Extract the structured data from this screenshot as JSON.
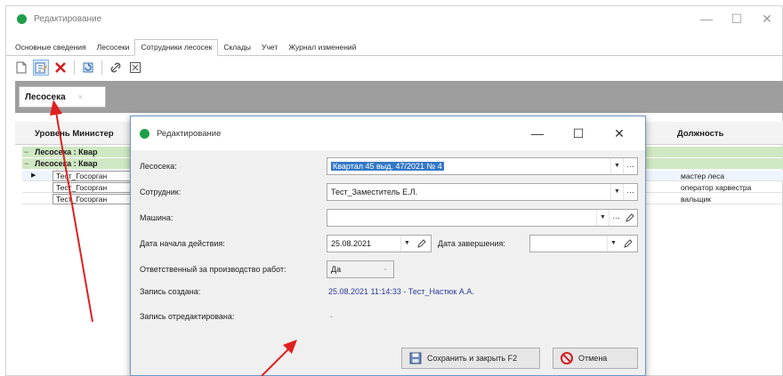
{
  "outer_window": {
    "title": "Редактирование",
    "controls": [
      "—",
      "☐",
      "✕"
    ]
  },
  "tabs": [
    {
      "label": "Основные сведения",
      "active": false
    },
    {
      "label": "Лесосеки",
      "active": false
    },
    {
      "label": "Сотрудники лесосек",
      "active": true
    },
    {
      "label": "Склады",
      "active": false
    },
    {
      "label": "Учет",
      "active": false
    },
    {
      "label": "Журнал изменений",
      "active": false
    }
  ],
  "toolbar": {
    "icons": [
      "new-icon",
      "edit-icon",
      "delete-icon",
      "refresh-icon",
      "link-icon",
      "expand-icon"
    ]
  },
  "inner_tab": {
    "label": "Лесосека",
    "close": "×"
  },
  "grid": {
    "header_left": "Уровень Министер",
    "header_right": "Должность",
    "group_rows": [
      {
        "toggle": "−",
        "label": "Лесосека : Квар"
      },
      {
        "toggle": "−",
        "label": "Лесосека : Квар"
      }
    ],
    "rows": [
      {
        "indicator": "▶",
        "name": "Тест_Госорган",
        "position": "мастер леса"
      },
      {
        "indicator": "",
        "name": "Тест_Госорган",
        "position": "оператор харвестра"
      },
      {
        "indicator": "",
        "name": "Тест_Госорган",
        "position": "вальщик"
      }
    ]
  },
  "dialog": {
    "title": "Редактирование",
    "controls": [
      "—",
      "☐",
      "✕"
    ],
    "fields": {
      "lesoseka_label": "Лесосека:",
      "lesoseka_value": "Квартал 45 выд. 47/2021 № 4",
      "employee_label": "Сотрудник:",
      "employee_value": "Тест_Заместитель Е.Л.",
      "machine_label": "Машина:",
      "machine_value": "",
      "start_label": "Дата начала действия:",
      "start_value": "25.08.2021",
      "end_label": "Дата завершения:",
      "end_value": "",
      "responsible_label": "Ответственный за производство работ:",
      "responsible_value": "Да",
      "created_label": "Запись создана:",
      "created_value": "25.08.2021 11:14:33 - Тест_Настюк А.А.",
      "edited_label": "Запись отредактирована:",
      "edited_value": "-"
    },
    "buttons": {
      "save": "Сохранить и закрыть F2",
      "cancel": "Отмена"
    }
  },
  "colors": {
    "accent_green": "#1e9e4a",
    "group_row_bg": "#cfe8c3",
    "selection_blue": "#3478c6",
    "annotation_red": "#e02020"
  }
}
